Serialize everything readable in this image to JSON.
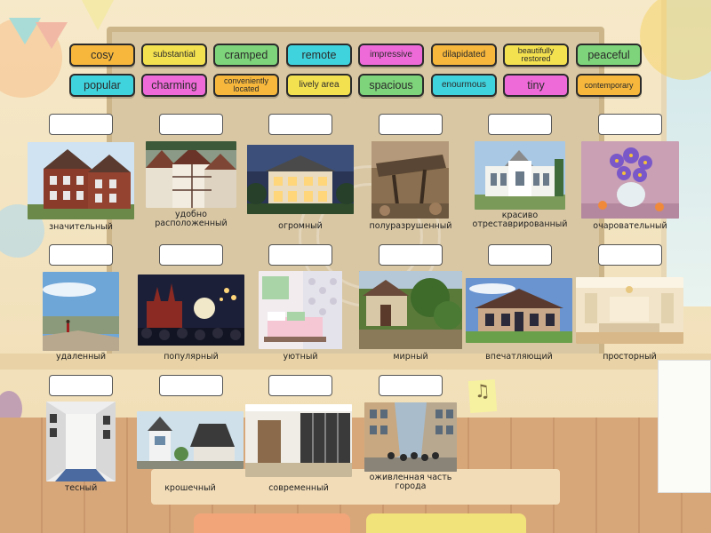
{
  "tiles": [
    {
      "label": "cosy",
      "color": "#f6b73c"
    },
    {
      "label": "substantial",
      "color": "#f4e150"
    },
    {
      "label": "cramped",
      "color": "#7ed47a"
    },
    {
      "label": "remote",
      "color": "#3fd3dd"
    },
    {
      "label": "impressive",
      "color": "#ee6ad8"
    },
    {
      "label": "dilapidated",
      "color": "#f6b73c"
    },
    {
      "label": "beautifully restored",
      "color": "#f4e150"
    },
    {
      "label": "peaceful",
      "color": "#7ed47a"
    },
    {
      "label": "popular",
      "color": "#3fd3dd"
    },
    {
      "label": "charming",
      "color": "#ee6ad8"
    },
    {
      "label": "conveniently located",
      "color": "#f6b73c"
    },
    {
      "label": "lively area",
      "color": "#f4e150"
    },
    {
      "label": "spacious",
      "color": "#7ed47a"
    },
    {
      "label": "enourmous",
      "color": "#3fd3dd"
    },
    {
      "label": "tiny",
      "color": "#ee6ad8"
    },
    {
      "label": "contemporary",
      "color": "#f6b73c"
    }
  ],
  "cards": [
    {
      "caption": "значительный",
      "scene": "victorian-brick-house"
    },
    {
      "caption": "удобно расположенный",
      "scene": "old-town-rooftops"
    },
    {
      "caption": "огромный",
      "scene": "villa-at-dusk"
    },
    {
      "caption": "полуразрушенный",
      "scene": "collapsed-building"
    },
    {
      "caption": "красиво отреставрированный",
      "scene": "white-restored-mansion"
    },
    {
      "caption": "очаровательный",
      "scene": "flower-bouquet"
    },
    {
      "caption": "удаленный",
      "scene": "hiker-on-ridge"
    },
    {
      "caption": "популярный",
      "scene": "red-square-at-night"
    },
    {
      "caption": "уютный",
      "scene": "cosy-bedroom"
    },
    {
      "caption": "мирный",
      "scene": "garden-courtyard"
    },
    {
      "caption": "впечатляющий",
      "scene": "stone-country-house"
    },
    {
      "caption": "просторный",
      "scene": "spacious-living-room"
    },
    {
      "caption": "тесный",
      "scene": "narrow-hallway"
    },
    {
      "caption": "крошечный",
      "scene": "tiny-house"
    },
    {
      "caption": "современный",
      "scene": "modern-wardrobe-room"
    },
    {
      "caption": "оживленная часть города",
      "scene": "busy-city-street"
    }
  ],
  "decor": {
    "note_symbol": "♫"
  }
}
